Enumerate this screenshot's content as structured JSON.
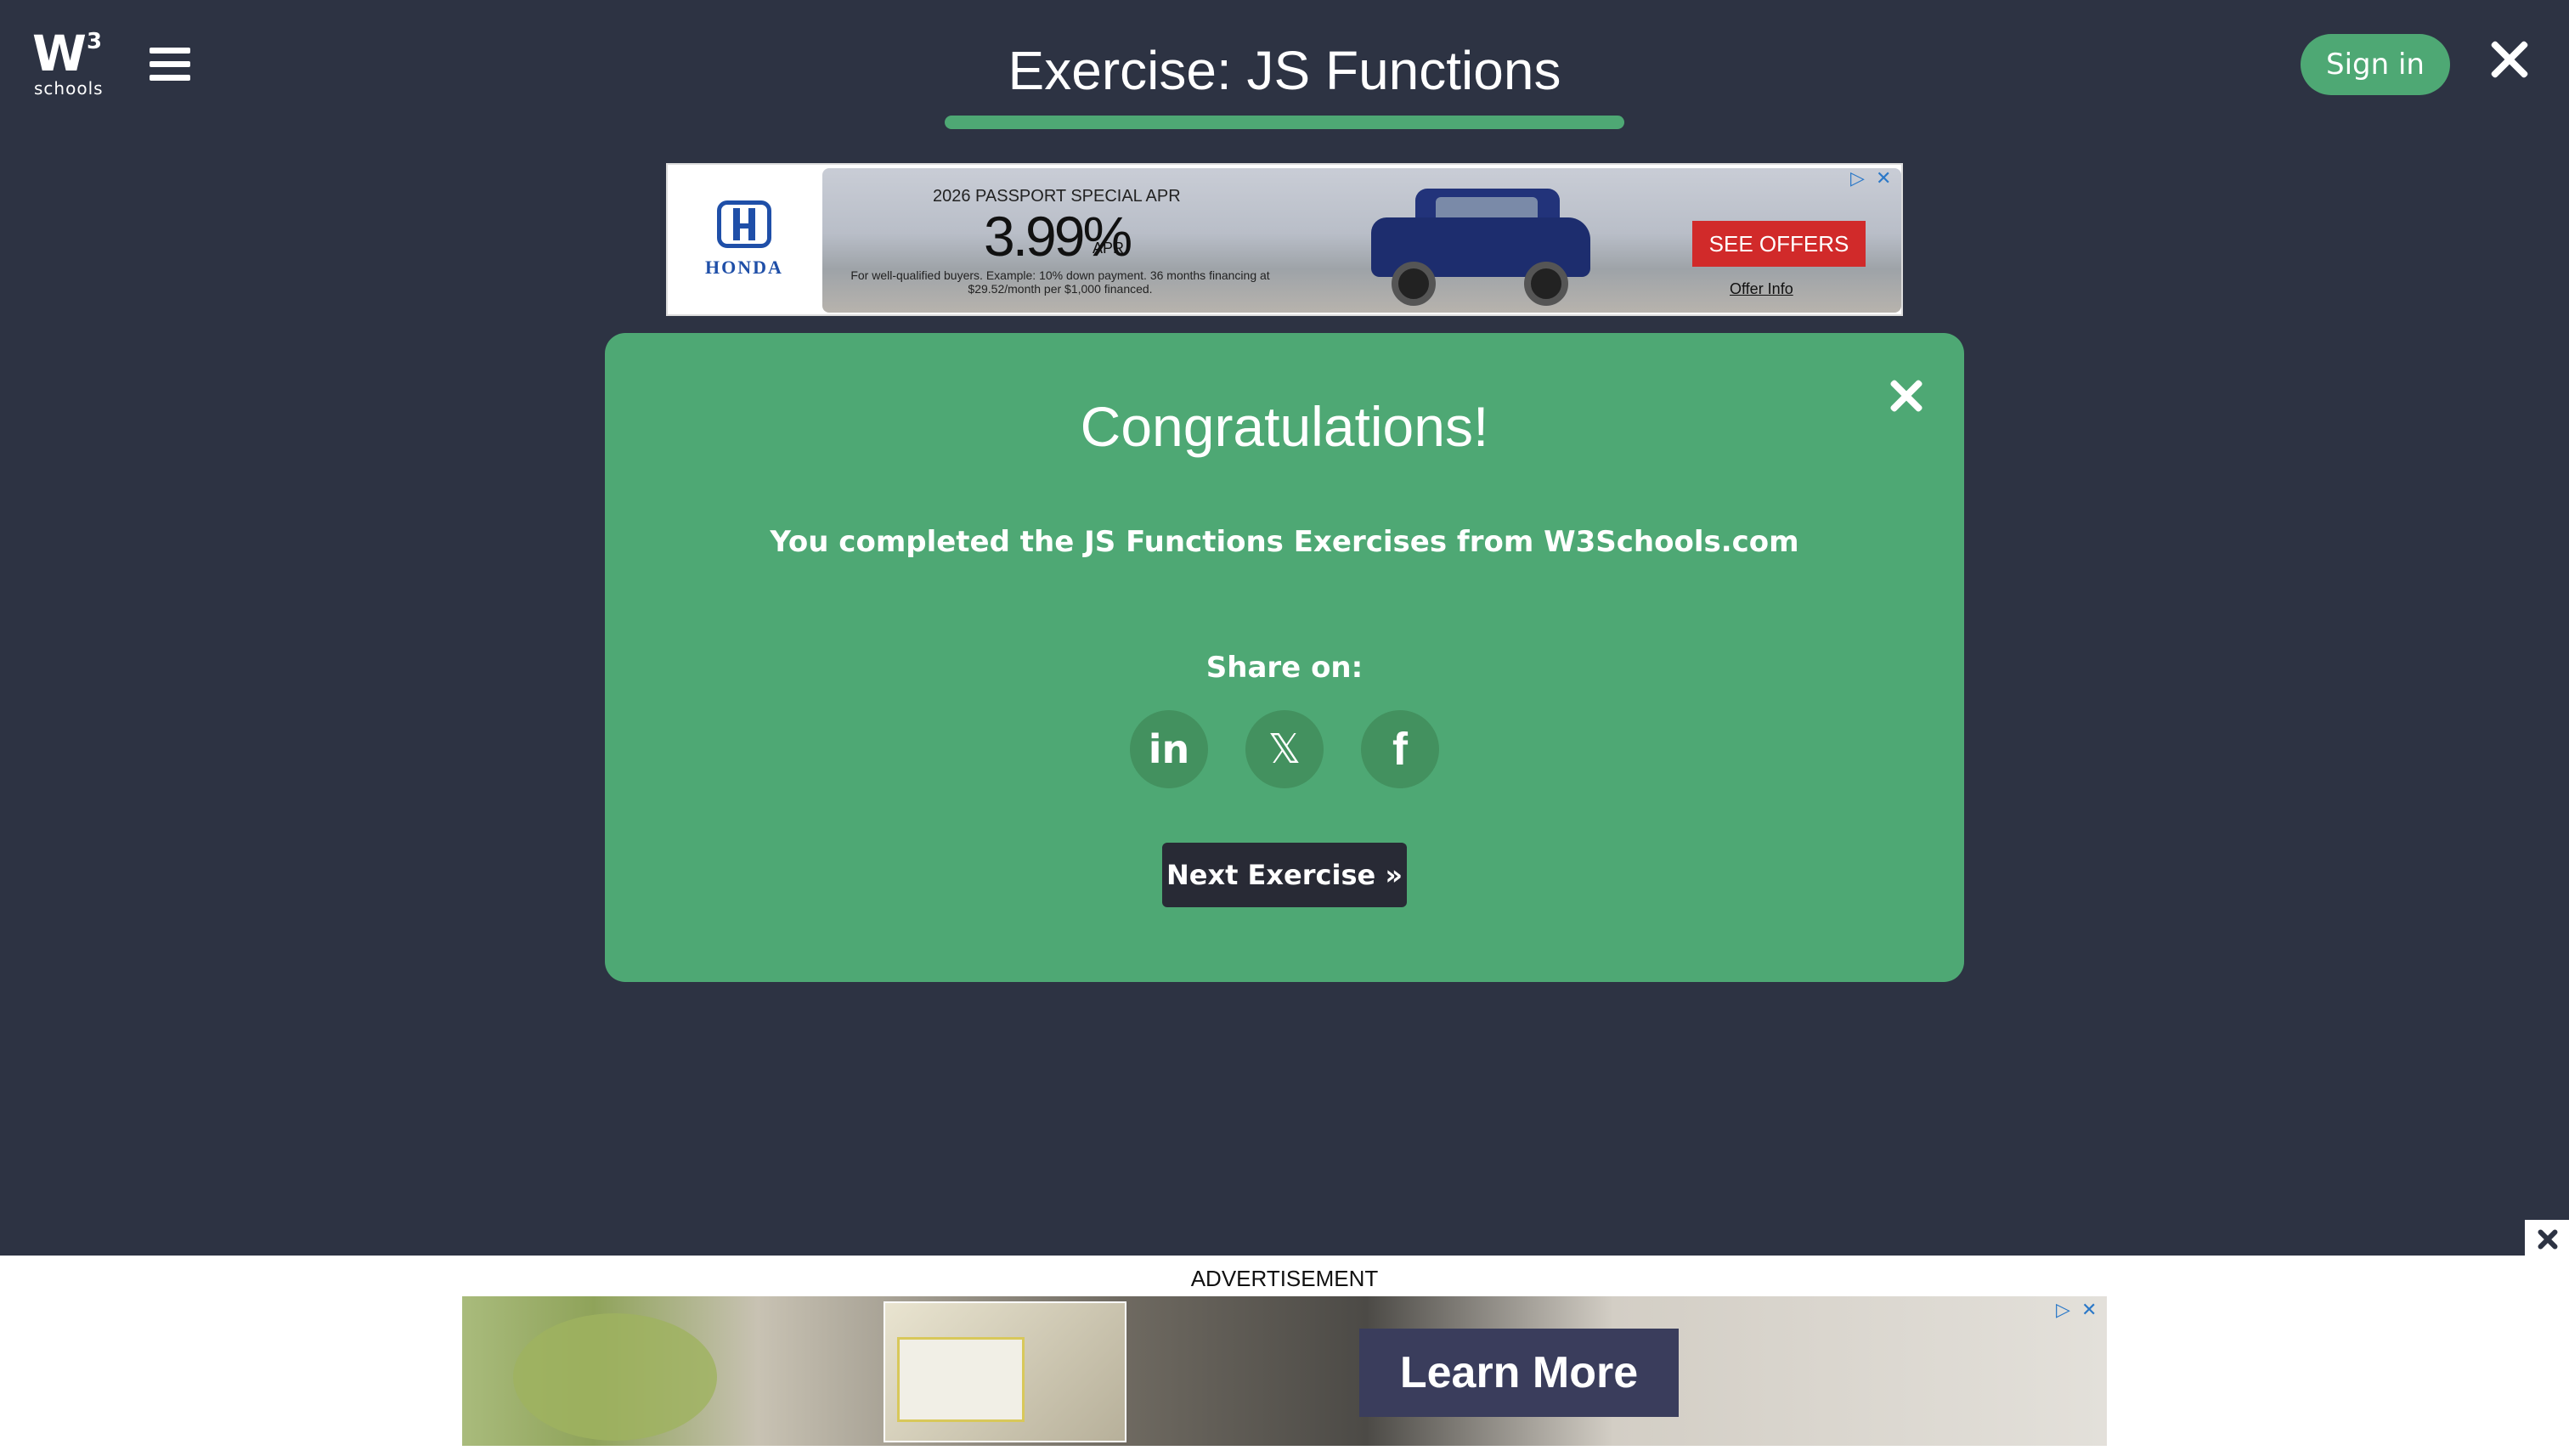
{
  "header": {
    "logo_text": "W",
    "logo_sup": "3",
    "logo_sub": "schools",
    "page_title": "Exercise: JS Functions",
    "signin_label": "Sign in"
  },
  "top_ad": {
    "brand": "HONDA",
    "headline": "2026 PASSPORT SPECIAL APR",
    "rate": "3.99%",
    "rate_unit": "APR",
    "fine_print": "For well-qualified buyers. Example: 10% down payment. 36 months financing at $29.52/month per $1,000 financed.",
    "cta": "SEE OFFERS",
    "offer_link": "Offer Info"
  },
  "panel": {
    "heading": "Congratulations!",
    "message": "You completed the JS Functions Exercises from W3Schools.com",
    "share_label": "Share on:",
    "share": {
      "linkedin": "in",
      "x": "𝕏",
      "facebook": "f"
    },
    "next_label": "Next Exercise »"
  },
  "bottom_ad": {
    "label": "ADVERTISEMENT",
    "cta": "Learn More"
  },
  "colors": {
    "background": "#2d3343",
    "accent": "#4ea874",
    "button_dark": "#282a35"
  }
}
